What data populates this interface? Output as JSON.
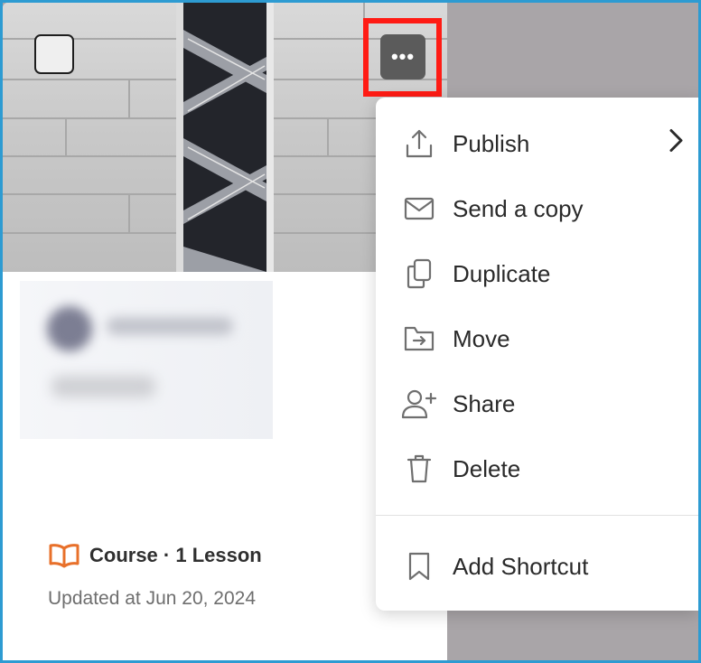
{
  "card": {
    "meta_label": "Course · 1 Lesson",
    "updated": "Updated at Jun 20, 2024",
    "more_button_glyph": "•••"
  },
  "menu": {
    "items": [
      {
        "label": "Publish",
        "icon": "upload-icon",
        "has_submenu": true
      },
      {
        "label": "Send a copy",
        "icon": "envelope-icon"
      },
      {
        "label": "Duplicate",
        "icon": "duplicate-icon"
      },
      {
        "label": "Move",
        "icon": "folder-move-icon"
      },
      {
        "label": "Share",
        "icon": "add-user-icon"
      },
      {
        "label": "Delete",
        "icon": "trash-icon"
      },
      {
        "label": "Add Shortcut",
        "icon": "bookmark-icon"
      }
    ]
  },
  "colors": {
    "highlight": "#ff1b14",
    "frame": "#2d9bd2",
    "course_icon": "#e8702a"
  }
}
